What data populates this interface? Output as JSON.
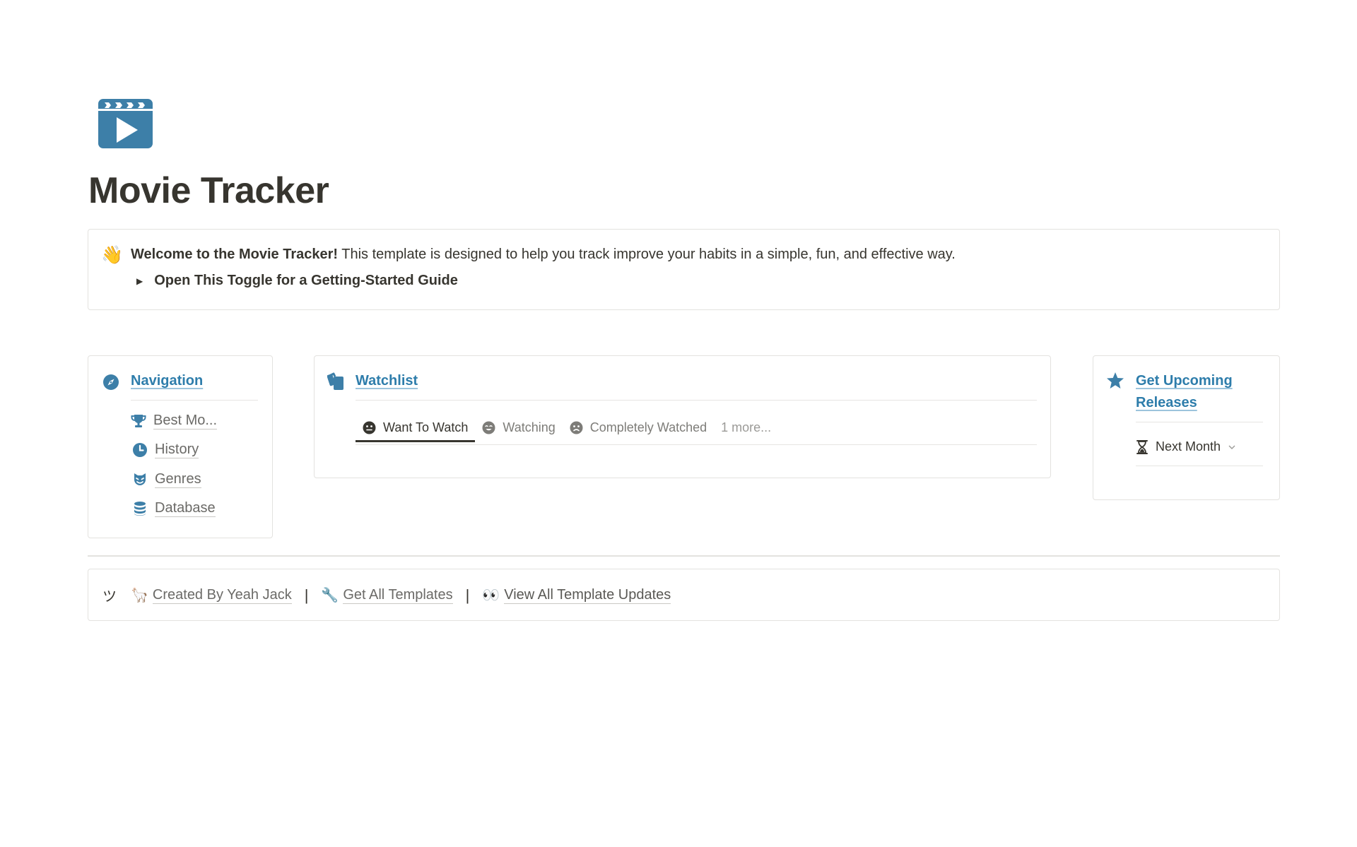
{
  "page": {
    "icon": "clapperboard-play-icon",
    "title": "Movie Tracker"
  },
  "callout": {
    "emoji": "👋",
    "bold_text": "Welcome to the Movie Tracker!",
    "text": " This template is designed to help you track improve your habits in a simple, fun, and effective way.",
    "toggle_label": "Open This Toggle for a Getting-Started Guide"
  },
  "navigation": {
    "title": "Navigation",
    "icon": "compass-icon",
    "items": [
      {
        "label": "Best Mo...",
        "icon": "trophy-icon"
      },
      {
        "label": "History",
        "icon": "clock-icon"
      },
      {
        "label": "Genres",
        "icon": "theater-mask-icon"
      },
      {
        "label": "Database",
        "icon": "database-icon"
      }
    ]
  },
  "watchlist": {
    "title": "Watchlist",
    "icon": "copy-pages-icon",
    "tabs": [
      {
        "label": "Want To Watch",
        "icon": "neutral-face-icon",
        "active": true
      },
      {
        "label": "Watching",
        "icon": "smile-face-icon",
        "active": false
      },
      {
        "label": "Completely Watched",
        "icon": "sad-face-icon",
        "active": false
      }
    ],
    "more_label": "1 more..."
  },
  "upcoming": {
    "title": "Get Upcoming Releases",
    "icon": "star-icon",
    "filter_label": "Next Month",
    "filter_icon": "hourglass-icon"
  },
  "footer": {
    "smile": "ツ",
    "links": [
      {
        "emoji": "🦙",
        "label": "Created By Yeah Jack"
      },
      {
        "emoji": "🔧",
        "label": "Get All Templates"
      },
      {
        "emoji": "👀",
        "label": "View All Template Updates"
      }
    ],
    "separator": "|"
  },
  "colors": {
    "accent": "#2e7dab",
    "icon_blue": "#3d7fa8",
    "text": "#37352f",
    "muted": "#7d7c78",
    "border": "#e3e2df"
  }
}
